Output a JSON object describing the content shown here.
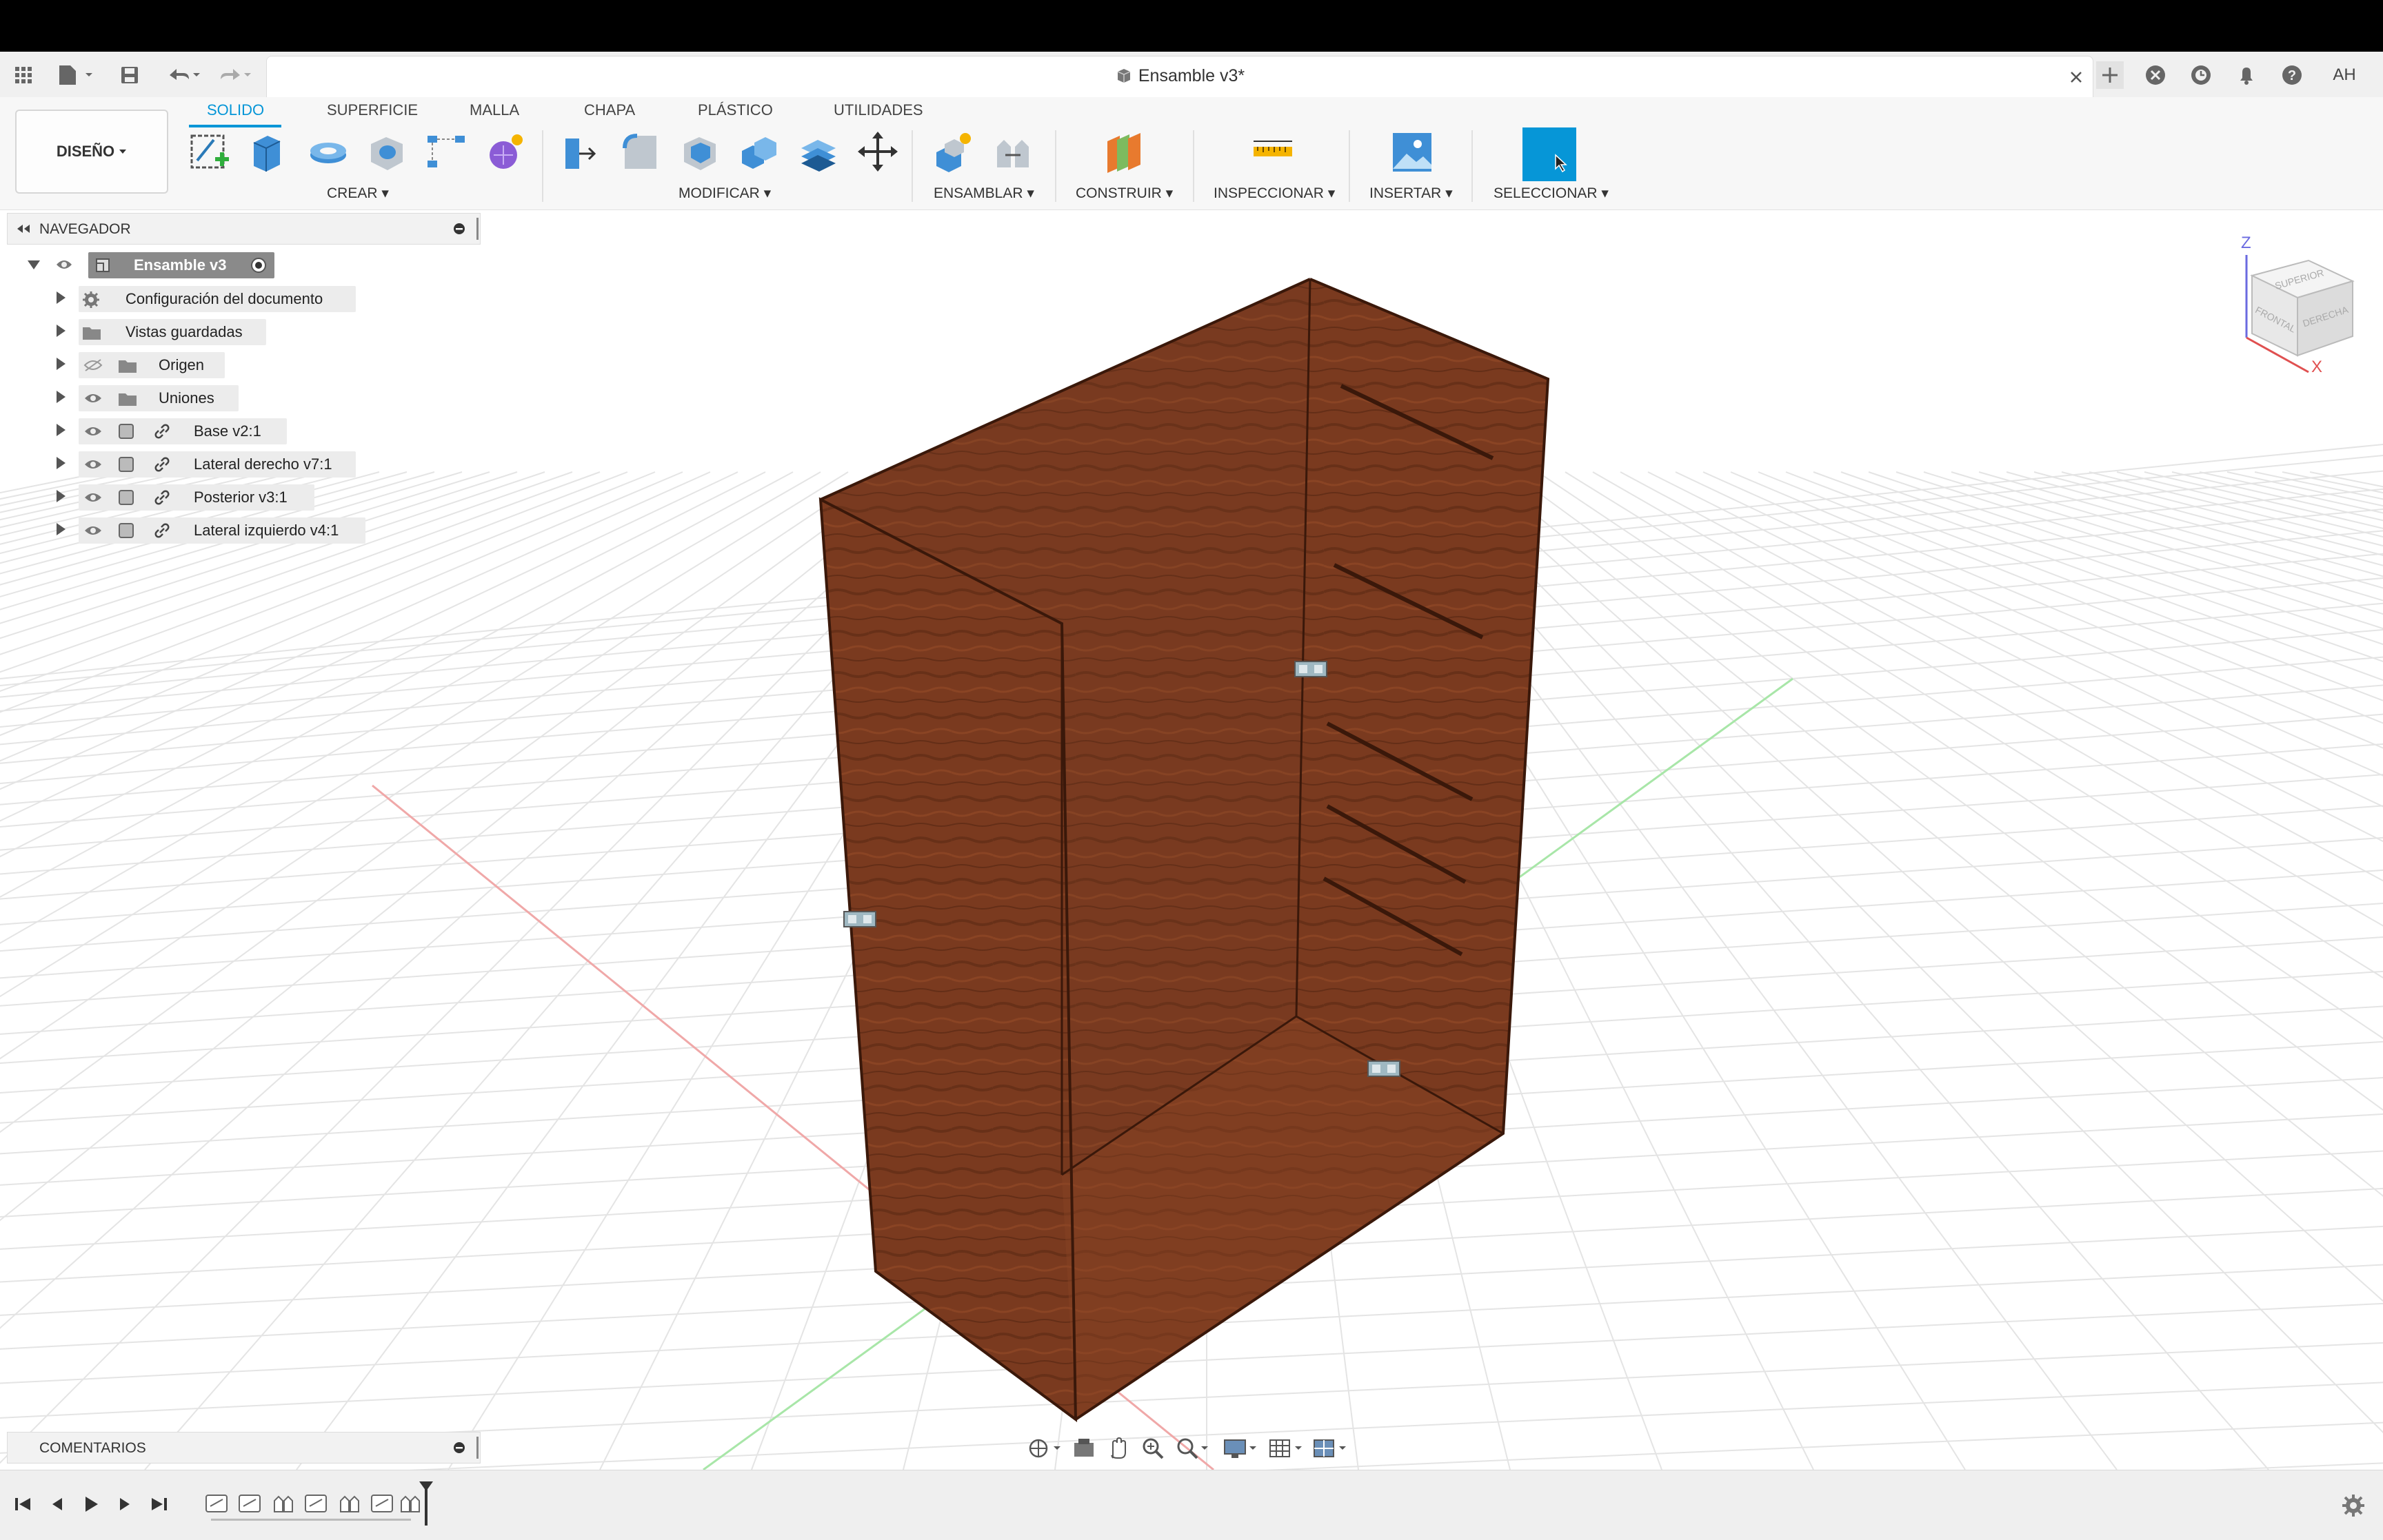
{
  "window": {
    "document_title": "Ensamble v3*",
    "user_initials": "AH"
  },
  "workspace": {
    "design_label": "DISEÑO"
  },
  "tabs": [
    {
      "label": "SOLIDO",
      "active": true
    },
    {
      "label": "SUPERFICIE",
      "active": false
    },
    {
      "label": "MALLA",
      "active": false
    },
    {
      "label": "CHAPA",
      "active": false
    },
    {
      "label": "PLÁSTICO",
      "active": false
    },
    {
      "label": "UTILIDADES",
      "active": false
    }
  ],
  "groups": {
    "crear": "CREAR",
    "modificar": "MODIFICAR",
    "ensamblar": "ENSAMBLAR",
    "construir": "CONSTRUIR",
    "inspeccionar": "INSPECCIONAR",
    "insertar": "INSERTAR",
    "seleccionar": "SELECCIONAR"
  },
  "navigator": {
    "title": "NAVEGADOR",
    "root": "Ensamble v3",
    "items": [
      {
        "label": "Configuración del documento",
        "icon": "gear-icon"
      },
      {
        "label": "Vistas guardadas",
        "icon": "folder-icon"
      },
      {
        "label": "Origen",
        "icon": "folder-icon"
      },
      {
        "label": "Uniones",
        "icon": "folder-icon"
      },
      {
        "label": "Base v2:1",
        "icon": "component-link-icon"
      },
      {
        "label": "Lateral derecho v7:1",
        "icon": "component-link-icon"
      },
      {
        "label": "Posterior v3:1",
        "icon": "component-link-icon"
      },
      {
        "label": "Lateral izquierdo v4:1",
        "icon": "component-link-icon"
      }
    ]
  },
  "comments": {
    "title": "COMENTARIOS"
  },
  "viewcube": {
    "faces": [
      "SUPERIOR",
      "FRONTAL",
      "DERECHA"
    ],
    "axes": [
      "Z",
      "X"
    ]
  },
  "colors": {
    "accent": "#0696d7",
    "wood": "#7a3a1f",
    "wood_dark": "#4b2212",
    "grid": "#e4e4e4",
    "axis_x": "#e57373",
    "axis_y": "#7bd67b"
  }
}
